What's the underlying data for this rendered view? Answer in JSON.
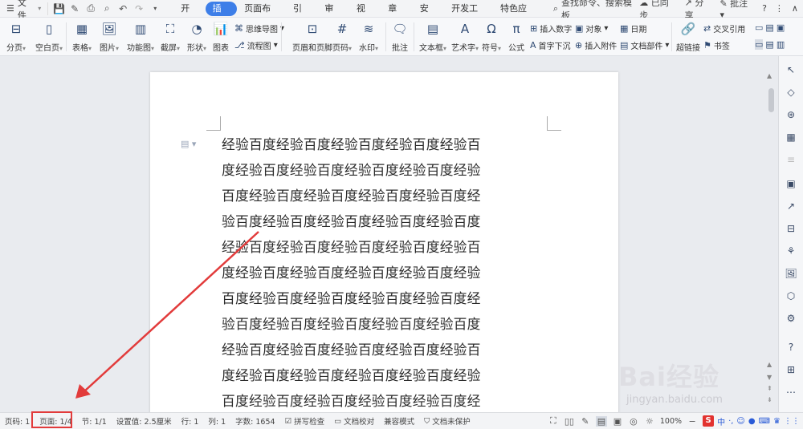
{
  "menubar": {
    "menu_label": "文件",
    "tabs": [
      "开始",
      "插入",
      "页面布局",
      "引用",
      "审阅",
      "视图",
      "章节",
      "安全",
      "开发工具",
      "特色应用"
    ],
    "active_tab": "插入",
    "search_text": "查找命令、搜索模板",
    "sync_label": "已同步",
    "share_label": "分享",
    "comment_label": "批注"
  },
  "ribbon": {
    "page_break": "分页",
    "blank_page": "空白页",
    "table": "表格",
    "picture": "图片",
    "function_chart": "功能图",
    "screenshot": "截屏",
    "shape": "形状",
    "chart": "图表",
    "mind_map": "思维导图",
    "flowchart": "流程图",
    "header_footer": "页眉和页脚",
    "page_number": "页码",
    "watermark": "水印",
    "comment": "批注",
    "textbox": "文本框",
    "art_text": "艺术字",
    "symbol": "符号",
    "formula": "公式",
    "insert_number": "插入数字",
    "object": "对象",
    "date": "日期",
    "drop_cap": "首字下沉",
    "attachment": "插入附件",
    "doc_part": "文档部件",
    "hyperlink": "超链接",
    "cross_ref": "交叉引用",
    "bookmark": "书签"
  },
  "document": {
    "lines": [
      "经验百度经验百度经验百度经验百度经验百",
      "度经验百度经验百度经验百度经验百度经验",
      "百度经验百度经验百度经验百度经验百度经",
      "验百度经验百度经验百度经验百度经验百度",
      "经验百度经验百度经验百度经验百度经验百",
      "度经验百度经验百度经验百度经验百度经验",
      "百度经验百度经验百度经验百度经验百度经",
      "验百度经验百度经验百度经验百度经验百度",
      "经验百度经验百度经验百度经验百度经验百",
      "度经验百度经验百度经验百度经验百度经验",
      "百度经验百度经验百度经验百度经验百度经"
    ]
  },
  "statusbar": {
    "page_code": "页码: 1",
    "page": "页面: 1/4",
    "section": "节: 1/1",
    "setting": "设置值: 2.5厘米",
    "row": "行: 1",
    "col": "列: 1",
    "word_count": "字数: 1654",
    "spell_check": "拼写检查",
    "doc_proof": "文档校对",
    "compat_mode": "兼容模式",
    "protect": "文档未保护",
    "zoom": "100%",
    "ime_lang": "中"
  },
  "watermark": {
    "brand": "Bai经验",
    "url": "jingyan.baidu.com"
  },
  "colors": {
    "accent": "#3d7ee8",
    "annotation_red": "#e23b3b"
  }
}
